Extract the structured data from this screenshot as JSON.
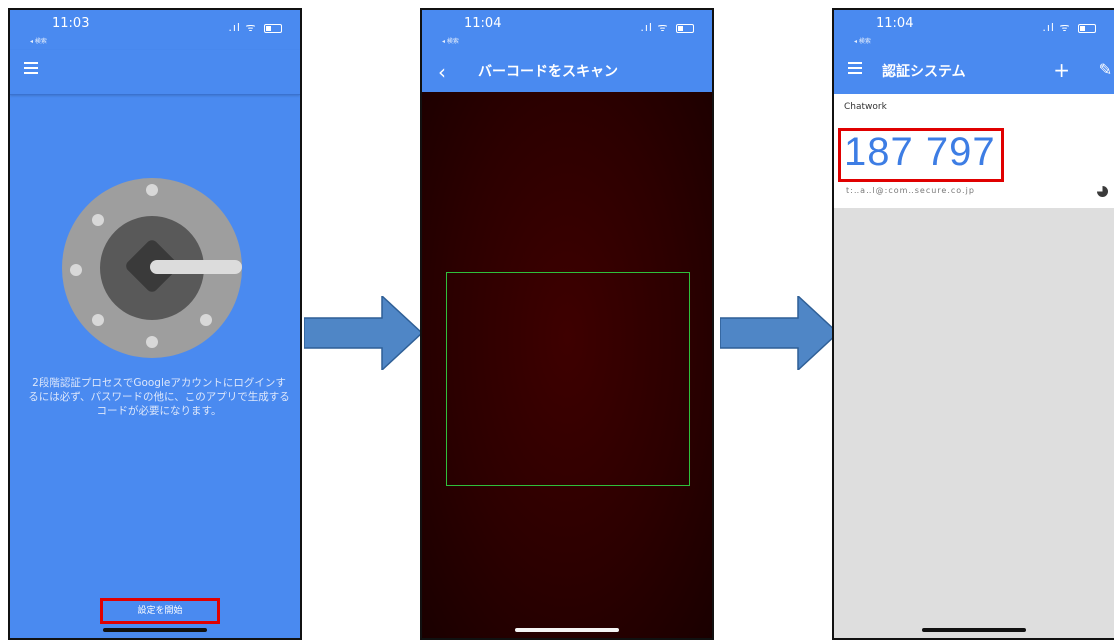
{
  "screen1": {
    "status_time": "11:03",
    "status_back": "◂ 検索",
    "intro_text": "2段階認証プロセスでGoogleアカウントにログインするには必ず、パスワードの他に、このアプリで生成するコードが必要になります。",
    "start_button": "設定を開始"
  },
  "screen2": {
    "status_time": "11:04",
    "status_back": "◂ 検索",
    "title": "バーコードをスキャン"
  },
  "screen3": {
    "status_time": "11:04",
    "status_back": "◂ 検索",
    "title": "認証システム",
    "add_symbol": "+",
    "account_name": "Chatwork",
    "code": "187 797",
    "issuer_text": "t:‥a‥l@:com‥secure.co.jp"
  },
  "icons": [
    "menu-icon",
    "battery-icon",
    "wifi-icon",
    "signal-icon",
    "back-chevron-icon",
    "plus-icon",
    "pencil-icon",
    "timer-icon",
    "authenticator-logo-icon",
    "right-arrow-icon"
  ],
  "colors": {
    "app_blue": "#4a8af0",
    "highlight_red": "#e00000",
    "scan_green": "#2fbf3b",
    "code_blue": "#3d7de4",
    "arrow_fill": "#4f86c6"
  }
}
